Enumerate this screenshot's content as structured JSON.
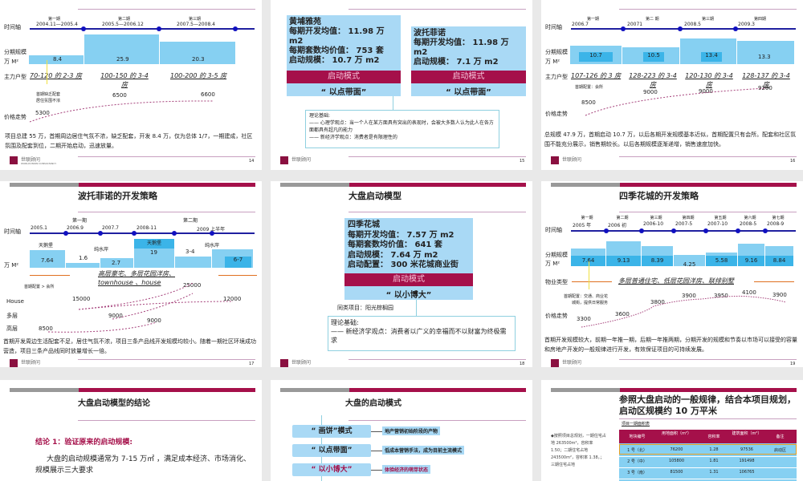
{
  "s14": {
    "axis_label": "时间轴",
    "scale_label": "分期规模",
    "unit": "万 M²",
    "type_label": "主力户型",
    "price_label": "价格走势",
    "phases": [
      {
        "name": "第一期",
        "date": "2004.11—2005.4",
        "scale": "8.4",
        "type": "70-120 的 2-3 房"
      },
      {
        "name": "第二期",
        "date": "2005.5—2006.12",
        "scale": "25.9",
        "type": "100-150 的 3-4 房"
      },
      {
        "name": "第三期",
        "date": "2007.5—2008.4",
        "scale": "20.3",
        "type": "100-200 的 3-5 房"
      }
    ],
    "note": [
      "首期缺乏配套",
      "居住氛围不浓"
    ],
    "prices": [
      "5300",
      "6500",
      "6600"
    ],
    "text": "项目总建 55 万，首期周边居住气氛不浓，缺乏配套，开发 8.4 万，仅为总体 1/7，一期建成，社区氛围及配套到位，二期开始启动，迅速放量。",
    "page": "14"
  },
  "s15": {
    "box1": [
      "黄埔雅苑",
      "每期开发均值： 11.98 万 m2",
      "每期套数均价值： 753 套",
      "启动规模： 10.7 万 m2"
    ],
    "box2": [
      "波托菲诺",
      "每期开发均值： 11.98 万 m2",
      "启动规模： 7.1 万 m2"
    ],
    "mode_label": "启动模式",
    "mode": "“ 以点带面”",
    "theory": [
      "理论基础:",
      "—— 心理学观点：当一个人在某方面具有突出的表现时，会被大多数人认为此人在各方面都具有超凡的能力",
      "—— 新经济学观点：消费者是有限理性的"
    ],
    "page": "15"
  },
  "s16": {
    "axis_label": "时间轴",
    "scale_label": "分期规模",
    "unit": "万 M²",
    "type_label": "主力户型",
    "price_label": "价格走势",
    "phases": [
      {
        "name": "第一期",
        "date": "2006.7",
        "scale": "10.7",
        "type": "107-126 的 3 房"
      },
      {
        "name": "第二 期",
        "date": "20071",
        "scale": "10.5",
        "type": "128-223 的 3-4 房"
      },
      {
        "name": "第三期",
        "date": "2008.5",
        "scale": "13.4",
        "type": "120-130 的 3-4 房"
      },
      {
        "name": "第四期",
        "date": "2009.3",
        "scale": "13.3",
        "type": "128-137 的 3-4 房"
      }
    ],
    "note": "首期配置：会所",
    "prices": [
      "8500",
      "9000",
      "9000",
      "9200"
    ],
    "text": "总规模 47.9 万，首期启动 10.7 万，以后各期开发规模基本近似，首期配置只有会所。配套和社区氛围不能充分展示，销售期较长。以后各期规模逐渐递增，销售速度加快。",
    "page": "16"
  },
  "s17": {
    "title": "波托菲诺的开发策略",
    "phase1": "第一期",
    "phase2": "第二期",
    "axis_label": "时间轴",
    "unit": "万 M²",
    "dates": [
      "2005.1",
      "2006.9",
      "2007.7",
      "2008-11",
      "2009 上半年"
    ],
    "bars": [
      {
        "name": "天鹅堡",
        "value": "7.64"
      },
      {
        "name": "纯水岸",
        "value": "1.6"
      },
      {
        "name": "",
        "value": "2.7"
      },
      {
        "name": "天鹅堡",
        "value": "19"
      },
      {
        "name": "纯水岸",
        "value": "3-4"
      },
      {
        "name": "",
        "value": "6-7"
      }
    ],
    "products": "高层豪宅、多层花园洋房、townhouse 、house",
    "note": "首期配置 > 会所",
    "rows": [
      "House",
      "多层",
      "高层"
    ],
    "prices": [
      "15000",
      "25000",
      "12000",
      "9000",
      "9000",
      "8500"
    ],
    "text": "首期开发周边生活配套不足，居住气氛不浓，项目三条产品线开发规模均较小。随着一期社区环境成功营造，项目三条产品线同时放量增长一倍。",
    "page": "17"
  },
  "s18": {
    "title": "大盘启动模型",
    "box": [
      "四季花城",
      "每期开发均值： 7.57 万 m2",
      "每期套数均价值： 641 套",
      "启动规模： 7.64 万 m2",
      "启动配置： 300 米花城商业街"
    ],
    "mode_label": "启动模式",
    "mode": "“ 以小博大”",
    "similar": "同类项目：阳光棕榈园",
    "theory": [
      "理论基础:",
      "—— 新经济学观点：消费者以广义的幸福而不以财富为终极需求"
    ],
    "page": "18"
  },
  "s19": {
    "title": "四季花城的开发策略",
    "axis_label": "时间轴",
    "scale_label": "分期规模",
    "unit": "万 M²",
    "type_label": "物业类型",
    "price_label": "价格走势",
    "phases": [
      {
        "name": "第一期",
        "date": "2005 年",
        "scale": "7.64"
      },
      {
        "name": "第二期",
        "date": "2006 初",
        "scale": "9.13"
      },
      {
        "name": "第三期",
        "date": "2006-10",
        "scale": "8.39"
      },
      {
        "name": "第四期",
        "date": "2007-5",
        "scale": "4.25"
      },
      {
        "name": "第五期",
        "date": "2007-10",
        "scale": "5.58"
      },
      {
        "name": "第六期",
        "date": "2008-5",
        "scale": "9.16"
      },
      {
        "name": "第七期",
        "date": "2008-9",
        "scale": "8.84"
      }
    ],
    "types": "多层普通住宅、低层花园洋房、联排别墅",
    "note": [
      "首期配置：交通、商业花",
      "城街，提供日常服务"
    ],
    "prices": [
      "3300",
      "3600",
      "3800",
      "3900",
      "3950",
      "4100",
      "3900"
    ],
    "text": "首期开发规模较大，前期一年推一期，后期一年推两期，分期开发的规模和节奏以市场可以接受的容量和房地产开发的一般规律进行开发，有效保证项目的可持续发展。",
    "page": "19"
  },
  "s20": {
    "title": "大盘启动模型的结论",
    "conclusion": "结论 1：验证原来的启动规模:",
    "body": "大盘的启动规模通常为 7-15 万㎡ ，满足成本经济、市场消化、规模展示三大要求"
  },
  "s21": {
    "title": "大盘的启动模式",
    "modes": [
      {
        "name": "“ 画饼”模式",
        "desc": "地产营销初始阶段的产物"
      },
      {
        "name": "“ 以点带面”",
        "desc": "低成本营销手法，成为目前主流模式"
      },
      {
        "name": "“ 以小博大”",
        "desc": "体验经济的萌芽状态"
      }
    ]
  },
  "s22": {
    "title": "参照大盘启动的一般规律，结合本项目规划，启动区规模约 10 万平米",
    "table_title": "项目一期面积表",
    "side": "◆按照项目总规划，一期住宅占地 263500m²，容积率 1.50；二期住宅占地 243500m²，容积率 1.38，；三期住宅占地",
    "headers": [
      "地块编号",
      "用地面积（m²）",
      "容积率",
      "建筑面积（m²）",
      "备注"
    ],
    "rows": [
      [
        "1 号（北）",
        "76200",
        "1.28",
        "97536",
        "启动区"
      ],
      [
        "2 号（中）",
        "105800",
        "1.81",
        "191498",
        ""
      ],
      [
        "3 号（南）",
        "81500",
        "1.31",
        "106765",
        ""
      ]
    ]
  },
  "brand": {
    "name": "世联顾问",
    "sub": "WORLDUNION CONSULTANCY"
  },
  "colors": {
    "accent": "#a5104a",
    "bar": "#86d0f2",
    "axis": "#2020a0"
  }
}
